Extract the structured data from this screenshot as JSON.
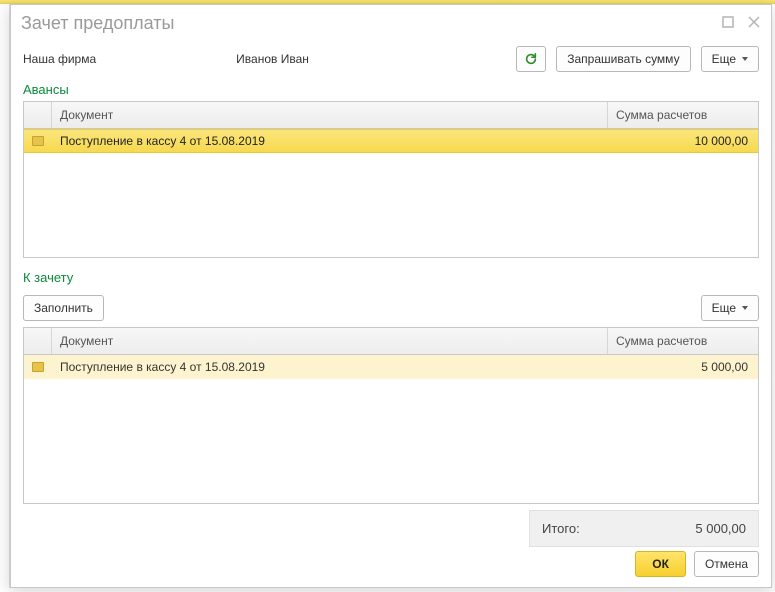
{
  "title": "Зачет предоплаты",
  "header": {
    "firm_label": "Наша фирма",
    "person": "Иванов Иван",
    "request_sum_btn": "Запрашивать сумму",
    "more_btn": "Еще"
  },
  "advances": {
    "title": "Авансы",
    "columns": {
      "doc": "Документ",
      "sum": "Сумма расчетов"
    },
    "rows": [
      {
        "doc": "Поступление в кассу 4 от 15.08.2019",
        "sum": "10 000,00"
      }
    ]
  },
  "offset": {
    "title": "К зачету",
    "fill_btn": "Заполнить",
    "more_btn": "Еще",
    "columns": {
      "doc": "Документ",
      "sum": "Сумма расчетов"
    },
    "rows": [
      {
        "doc": "Поступление в кассу 4 от 15.08.2019",
        "sum": "5 000,00"
      }
    ]
  },
  "total": {
    "label": "Итого:",
    "value": "5 000,00"
  },
  "footer": {
    "ok": "ОК",
    "cancel": "Отмена"
  }
}
